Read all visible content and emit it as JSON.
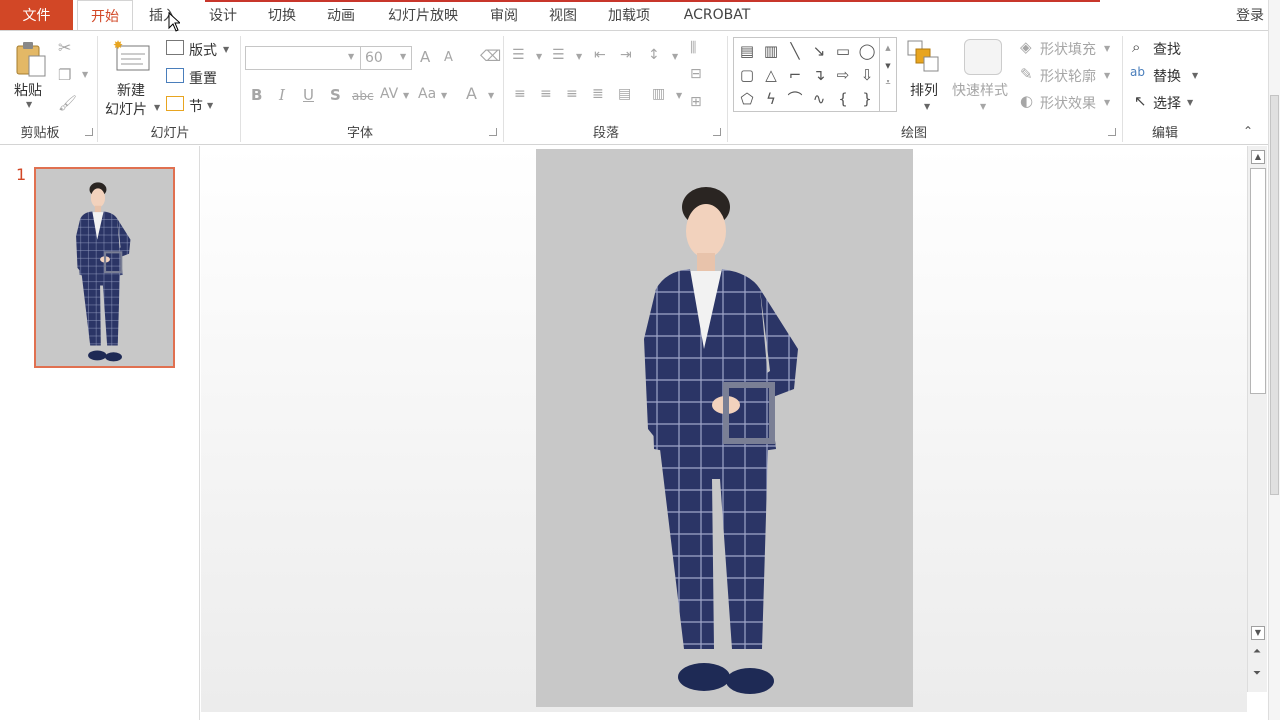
{
  "tabs": {
    "file": "文件",
    "items": [
      {
        "label": "开始",
        "active": true
      },
      {
        "label": "插入"
      },
      {
        "label": "设计"
      },
      {
        "label": "切换"
      },
      {
        "label": "动画"
      },
      {
        "label": "幻灯片放映"
      },
      {
        "label": "审阅"
      },
      {
        "label": "视图"
      },
      {
        "label": "加载项"
      },
      {
        "label": "ACROBAT"
      }
    ],
    "login": "登录"
  },
  "clipboard": {
    "paste": "粘贴",
    "group": "剪贴板"
  },
  "slides": {
    "new_line1": "新建",
    "new_line2": "幻灯片",
    "layout": "版式",
    "reset": "重置",
    "section": "节",
    "group": "幻灯片"
  },
  "font": {
    "size": "60",
    "group": "字体",
    "bold": "B",
    "italic": "I",
    "underline": "U",
    "shadow": "S",
    "strike": "abc",
    "spacing": "AV",
    "case": "Aa",
    "color": "A",
    "grow": "A",
    "shrink": "A"
  },
  "paragraph": {
    "group": "段落"
  },
  "drawing": {
    "arrange": "排列",
    "quick_styles": "快速样式",
    "fill": "形状填充",
    "outline": "形状轮廓",
    "effects": "形状效果",
    "group": "绘图"
  },
  "editing": {
    "find": "查找",
    "replace": "替换",
    "select": "选择",
    "group": "编辑"
  },
  "thumbnail": {
    "number": "1"
  },
  "colors": {
    "accent": "#d24726",
    "slide_bg": "#c8c8c8",
    "suit": "#2b3566"
  }
}
